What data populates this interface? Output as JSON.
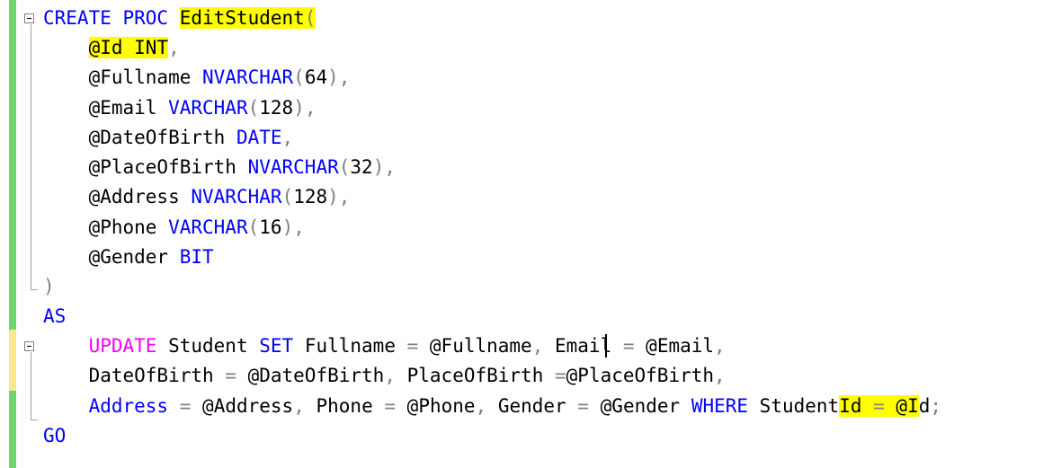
{
  "editor": {
    "colors": {
      "keyword": "#0000ff",
      "dml_keyword": "#ff00ff",
      "operator": "#808080",
      "identifier": "#000000",
      "highlight": "#ffff00",
      "change_bar_saved": "#6fd36f",
      "change_bar_unsaved": "#f7e98b"
    },
    "fold_icons": [
      "collapse-icon",
      "collapse-icon"
    ],
    "lines": [
      {
        "tokens": [
          {
            "text": "CREATE PROC ",
            "type": "kw"
          },
          {
            "text": "EditStudent",
            "type": "plain",
            "hl": true
          },
          {
            "text": "(",
            "type": "op",
            "hl": true
          }
        ]
      },
      {
        "tokens": [
          {
            "text": "    "
          },
          {
            "text": "@Id INT",
            "type": "plain",
            "hl": true
          },
          {
            "text": ",",
            "type": "op"
          }
        ]
      },
      {
        "tokens": [
          {
            "text": "    "
          },
          {
            "text": "@Fullname ",
            "type": "plain"
          },
          {
            "text": "NVARCHAR",
            "type": "kw"
          },
          {
            "text": "(",
            "type": "op"
          },
          {
            "text": "64",
            "type": "plain"
          },
          {
            "text": "),",
            "type": "op"
          }
        ]
      },
      {
        "tokens": [
          {
            "text": "    "
          },
          {
            "text": "@Email ",
            "type": "plain"
          },
          {
            "text": "VARCHAR",
            "type": "kw"
          },
          {
            "text": "(",
            "type": "op"
          },
          {
            "text": "128",
            "type": "plain"
          },
          {
            "text": "),",
            "type": "op"
          }
        ]
      },
      {
        "tokens": [
          {
            "text": "    "
          },
          {
            "text": "@DateOfBirth ",
            "type": "plain"
          },
          {
            "text": "DATE",
            "type": "kw"
          },
          {
            "text": ",",
            "type": "op"
          }
        ]
      },
      {
        "tokens": [
          {
            "text": "    "
          },
          {
            "text": "@PlaceOfBirth ",
            "type": "plain"
          },
          {
            "text": "NVARCHAR",
            "type": "kw"
          },
          {
            "text": "(",
            "type": "op"
          },
          {
            "text": "32",
            "type": "plain"
          },
          {
            "text": "),",
            "type": "op"
          }
        ]
      },
      {
        "tokens": [
          {
            "text": "    "
          },
          {
            "text": "@Address ",
            "type": "plain"
          },
          {
            "text": "NVARCHAR",
            "type": "kw"
          },
          {
            "text": "(",
            "type": "op"
          },
          {
            "text": "128",
            "type": "plain"
          },
          {
            "text": "),",
            "type": "op"
          }
        ]
      },
      {
        "tokens": [
          {
            "text": "    "
          },
          {
            "text": "@Phone ",
            "type": "plain"
          },
          {
            "text": "VARCHAR",
            "type": "kw"
          },
          {
            "text": "(",
            "type": "op"
          },
          {
            "text": "16",
            "type": "plain"
          },
          {
            "text": "),",
            "type": "op"
          }
        ]
      },
      {
        "tokens": [
          {
            "text": "    "
          },
          {
            "text": "@Gender ",
            "type": "plain"
          },
          {
            "text": "BIT",
            "type": "kw"
          }
        ]
      },
      {
        "tokens": [
          {
            "text": ")",
            "type": "op"
          }
        ]
      },
      {
        "tokens": [
          {
            "text": "AS",
            "type": "kw"
          }
        ]
      },
      {
        "tokens": [
          {
            "text": "    "
          },
          {
            "text": "UPDATE",
            "type": "dml"
          },
          {
            "text": " Student ",
            "type": "plain"
          },
          {
            "text": "SET",
            "type": "kw"
          },
          {
            "text": " Fullname ",
            "type": "plain"
          },
          {
            "text": "=",
            "type": "op"
          },
          {
            "text": " @Fullname",
            "type": "plain"
          },
          {
            "text": ",",
            "type": "op"
          },
          {
            "text": " Email ",
            "type": "plain"
          },
          {
            "text": "=",
            "type": "op"
          },
          {
            "text": " @Email",
            "type": "plain"
          },
          {
            "text": ",",
            "type": "op"
          }
        ]
      },
      {
        "tokens": [
          {
            "text": "    "
          },
          {
            "text": "DateOfBirth ",
            "type": "plain"
          },
          {
            "text": "=",
            "type": "op"
          },
          {
            "text": " @DateOfBirth",
            "type": "plain"
          },
          {
            "text": ",",
            "type": "op"
          },
          {
            "text": " PlaceOfBirth ",
            "type": "plain"
          },
          {
            "text": "=",
            "type": "op"
          },
          {
            "text": "@PlaceOfBirth",
            "type": "plain"
          },
          {
            "text": ",",
            "type": "op"
          }
        ]
      },
      {
        "tokens": [
          {
            "text": "    "
          },
          {
            "text": "Address",
            "type": "kw"
          },
          {
            "text": " ",
            "type": "plain"
          },
          {
            "text": "=",
            "type": "op"
          },
          {
            "text": " @Address",
            "type": "plain"
          },
          {
            "text": ",",
            "type": "op"
          },
          {
            "text": " Phone ",
            "type": "plain"
          },
          {
            "text": "=",
            "type": "op"
          },
          {
            "text": " @Phone",
            "type": "plain"
          },
          {
            "text": ",",
            "type": "op"
          },
          {
            "text": " Gender ",
            "type": "plain"
          },
          {
            "text": "=",
            "type": "op"
          },
          {
            "text": " @Gender ",
            "type": "plain"
          },
          {
            "text": "WHERE",
            "type": "kw"
          },
          {
            "text": " Student",
            "type": "plain"
          },
          {
            "text": "Id ",
            "type": "plain",
            "hl": true
          },
          {
            "text": "=",
            "type": "op",
            "hl": true
          },
          {
            "text": " @I",
            "type": "plain",
            "hl": true
          },
          {
            "text": "d",
            "type": "plain"
          },
          {
            "text": ";",
            "type": "op"
          }
        ]
      },
      {
        "tokens": [
          {
            "text": "GO",
            "type": "kw"
          }
        ]
      }
    ]
  }
}
